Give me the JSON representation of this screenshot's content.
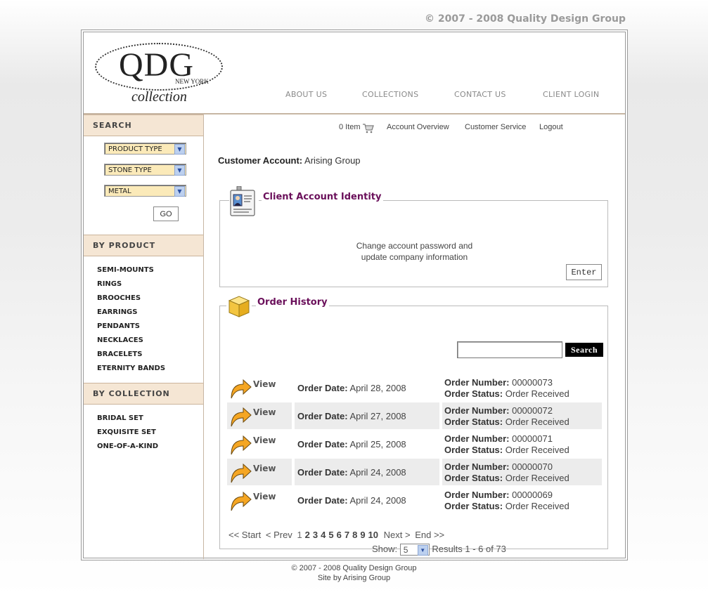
{
  "top_copyright": "© 2007 - 2008 Quality Design Group",
  "logo": {
    "main": "QDG",
    "sub": "NEW YORK",
    "script": "collection"
  },
  "nav": [
    "ABOUT US",
    "COLLECTIONS",
    "CONTACT US",
    "CLIENT LOGIN"
  ],
  "sidebar": {
    "search_title": "SEARCH",
    "selects": [
      "PRODUCT TYPE",
      "STONE TYPE",
      "METAL"
    ],
    "go_label": "GO",
    "by_product_title": "BY PRODUCT",
    "products": [
      "SEMI-MOUNTS",
      "RINGS",
      "BROOCHES",
      "EARRINGS",
      "PENDANTS",
      "NECKLACES",
      "BRACELETS",
      "ETERNITY BANDS"
    ],
    "by_collection_title": "BY COLLECTION",
    "collections": [
      "BRIDAL SET",
      "EXQUISITE SET",
      "ONE-OF-A-KIND"
    ]
  },
  "toplinks": {
    "cart": "0 Item",
    "overview": "Account Overview",
    "service": "Customer Service",
    "logout": "Logout"
  },
  "customer": {
    "label": "Customer Account:",
    "name": "Arising Group"
  },
  "identity": {
    "title": "Client Account Identity",
    "text_line1": "Change account password and",
    "text_line2": "update company information",
    "enter_label": "Enter"
  },
  "orders": {
    "title": "Order History",
    "search_value": "",
    "search_label": "Search",
    "view_label": "View",
    "date_label": "Order Date:",
    "number_label": "Order Number:",
    "status_label": "Order Status:",
    "rows": [
      {
        "date": "April 28, 2008",
        "number": "00000073",
        "status": "Order Received"
      },
      {
        "date": "April 27, 2008",
        "number": "00000072",
        "status": "Order Received"
      },
      {
        "date": "April 25, 2008",
        "number": "00000071",
        "status": "Order Received"
      },
      {
        "date": "April 24, 2008",
        "number": "00000070",
        "status": "Order Received"
      },
      {
        "date": "April 24, 2008",
        "number": "00000069",
        "status": "Order Received"
      }
    ],
    "pager": {
      "start": "<< Start",
      "prev": "< Prev",
      "pages": [
        "1",
        "2",
        "3",
        "4",
        "5",
        "6",
        "7",
        "8",
        "9",
        "10"
      ],
      "next": "Next >",
      "end": "End >>"
    },
    "show_label": "Show:",
    "show_value": "5",
    "results": "Results 1 - 6 of 73"
  },
  "footer": {
    "line1": "© 2007 - 2008 Quality Design Group",
    "line2": "Site by Arising Group"
  },
  "colors": {
    "accent_title": "#6a0f5a",
    "sidebar_header_bg": "#f5e6d4",
    "select_bg": "#fbeab9"
  }
}
